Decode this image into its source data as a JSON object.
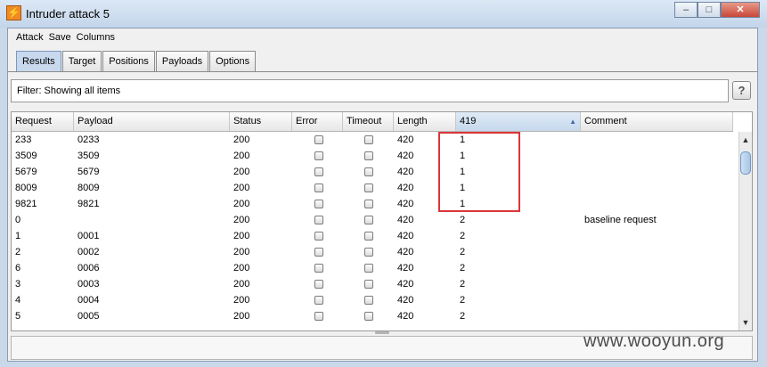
{
  "window": {
    "title": "Intruder attack 5",
    "app_icon_glyph": "⚡"
  },
  "menu": [
    "Attack",
    "Save",
    "Columns"
  ],
  "tabs": [
    "Results",
    "Target",
    "Positions",
    "Payloads",
    "Options"
  ],
  "active_tab": "Results",
  "filter": {
    "text": "Filter:  Showing all items"
  },
  "help_label": "?",
  "table": {
    "columns": [
      "Request",
      "Payload",
      "Status",
      "Error",
      "Timeout",
      "Length",
      "419",
      "Comment"
    ],
    "sorted_column": "419",
    "rows": [
      {
        "request": "233",
        "payload": "0233",
        "status": "200",
        "length": "420",
        "c419": "1",
        "comment": ""
      },
      {
        "request": "3509",
        "payload": "3509",
        "status": "200",
        "length": "420",
        "c419": "1",
        "comment": ""
      },
      {
        "request": "5679",
        "payload": "5679",
        "status": "200",
        "length": "420",
        "c419": "1",
        "comment": ""
      },
      {
        "request": "8009",
        "payload": "8009",
        "status": "200",
        "length": "420",
        "c419": "1",
        "comment": ""
      },
      {
        "request": "9821",
        "payload": "9821",
        "status": "200",
        "length": "420",
        "c419": "1",
        "comment": ""
      },
      {
        "request": "0",
        "payload": "",
        "status": "200",
        "length": "420",
        "c419": "2",
        "comment": "baseline request"
      },
      {
        "request": "1",
        "payload": "0001",
        "status": "200",
        "length": "420",
        "c419": "2",
        "comment": ""
      },
      {
        "request": "2",
        "payload": "0002",
        "status": "200",
        "length": "420",
        "c419": "2",
        "comment": ""
      },
      {
        "request": "6",
        "payload": "0006",
        "status": "200",
        "length": "420",
        "c419": "2",
        "comment": ""
      },
      {
        "request": "3",
        "payload": "0003",
        "status": "200",
        "length": "420",
        "c419": "2",
        "comment": ""
      },
      {
        "request": "4",
        "payload": "0004",
        "status": "200",
        "length": "420",
        "c419": "2",
        "comment": ""
      },
      {
        "request": "5",
        "payload": "0005",
        "status": "200",
        "length": "420",
        "c419": "2",
        "comment": ""
      }
    ]
  },
  "watermark": "www.wooyun.org",
  "colors": {
    "highlight": "#d9363a",
    "active_tab": "#c8d9ee"
  }
}
